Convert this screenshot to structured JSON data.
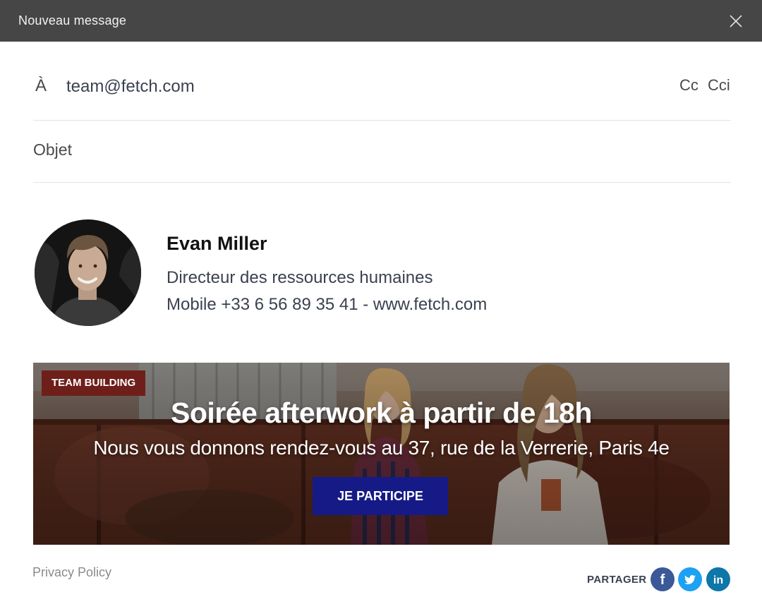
{
  "window": {
    "title": "Nouveau message"
  },
  "compose": {
    "to_label": "À",
    "to_value": "team@fetch.com",
    "cc_label": "Cc",
    "bcc_label": "Cci",
    "subject_placeholder": "Objet"
  },
  "signature": {
    "name": "Evan Miller",
    "role": "Directeur des ressources humaines",
    "contact": "Mobile +33 6 56 89 35 41 - www.fetch.com"
  },
  "banner": {
    "tag": "TEAM BUILDING",
    "title": "Soirée afterwork à partir de 18h",
    "subtitle": "Nous vous donnons rendez-vous au 37, rue de la Verrerie, Paris 4e",
    "cta": "JE PARTICIPE"
  },
  "footer": {
    "privacy": "Privacy Policy",
    "share_label": "PARTAGER",
    "social": [
      {
        "icon": "facebook-icon",
        "glyph": "f",
        "color": "#3b5998"
      },
      {
        "icon": "twitter-icon",
        "glyph": "",
        "color": "#1da1f2"
      },
      {
        "icon": "linkedin-icon",
        "glyph": "in",
        "color": "#0e76a8"
      }
    ]
  },
  "colors": {
    "titlebar": "#464646",
    "tag": "#6e1f19",
    "cta": "#161a86"
  }
}
